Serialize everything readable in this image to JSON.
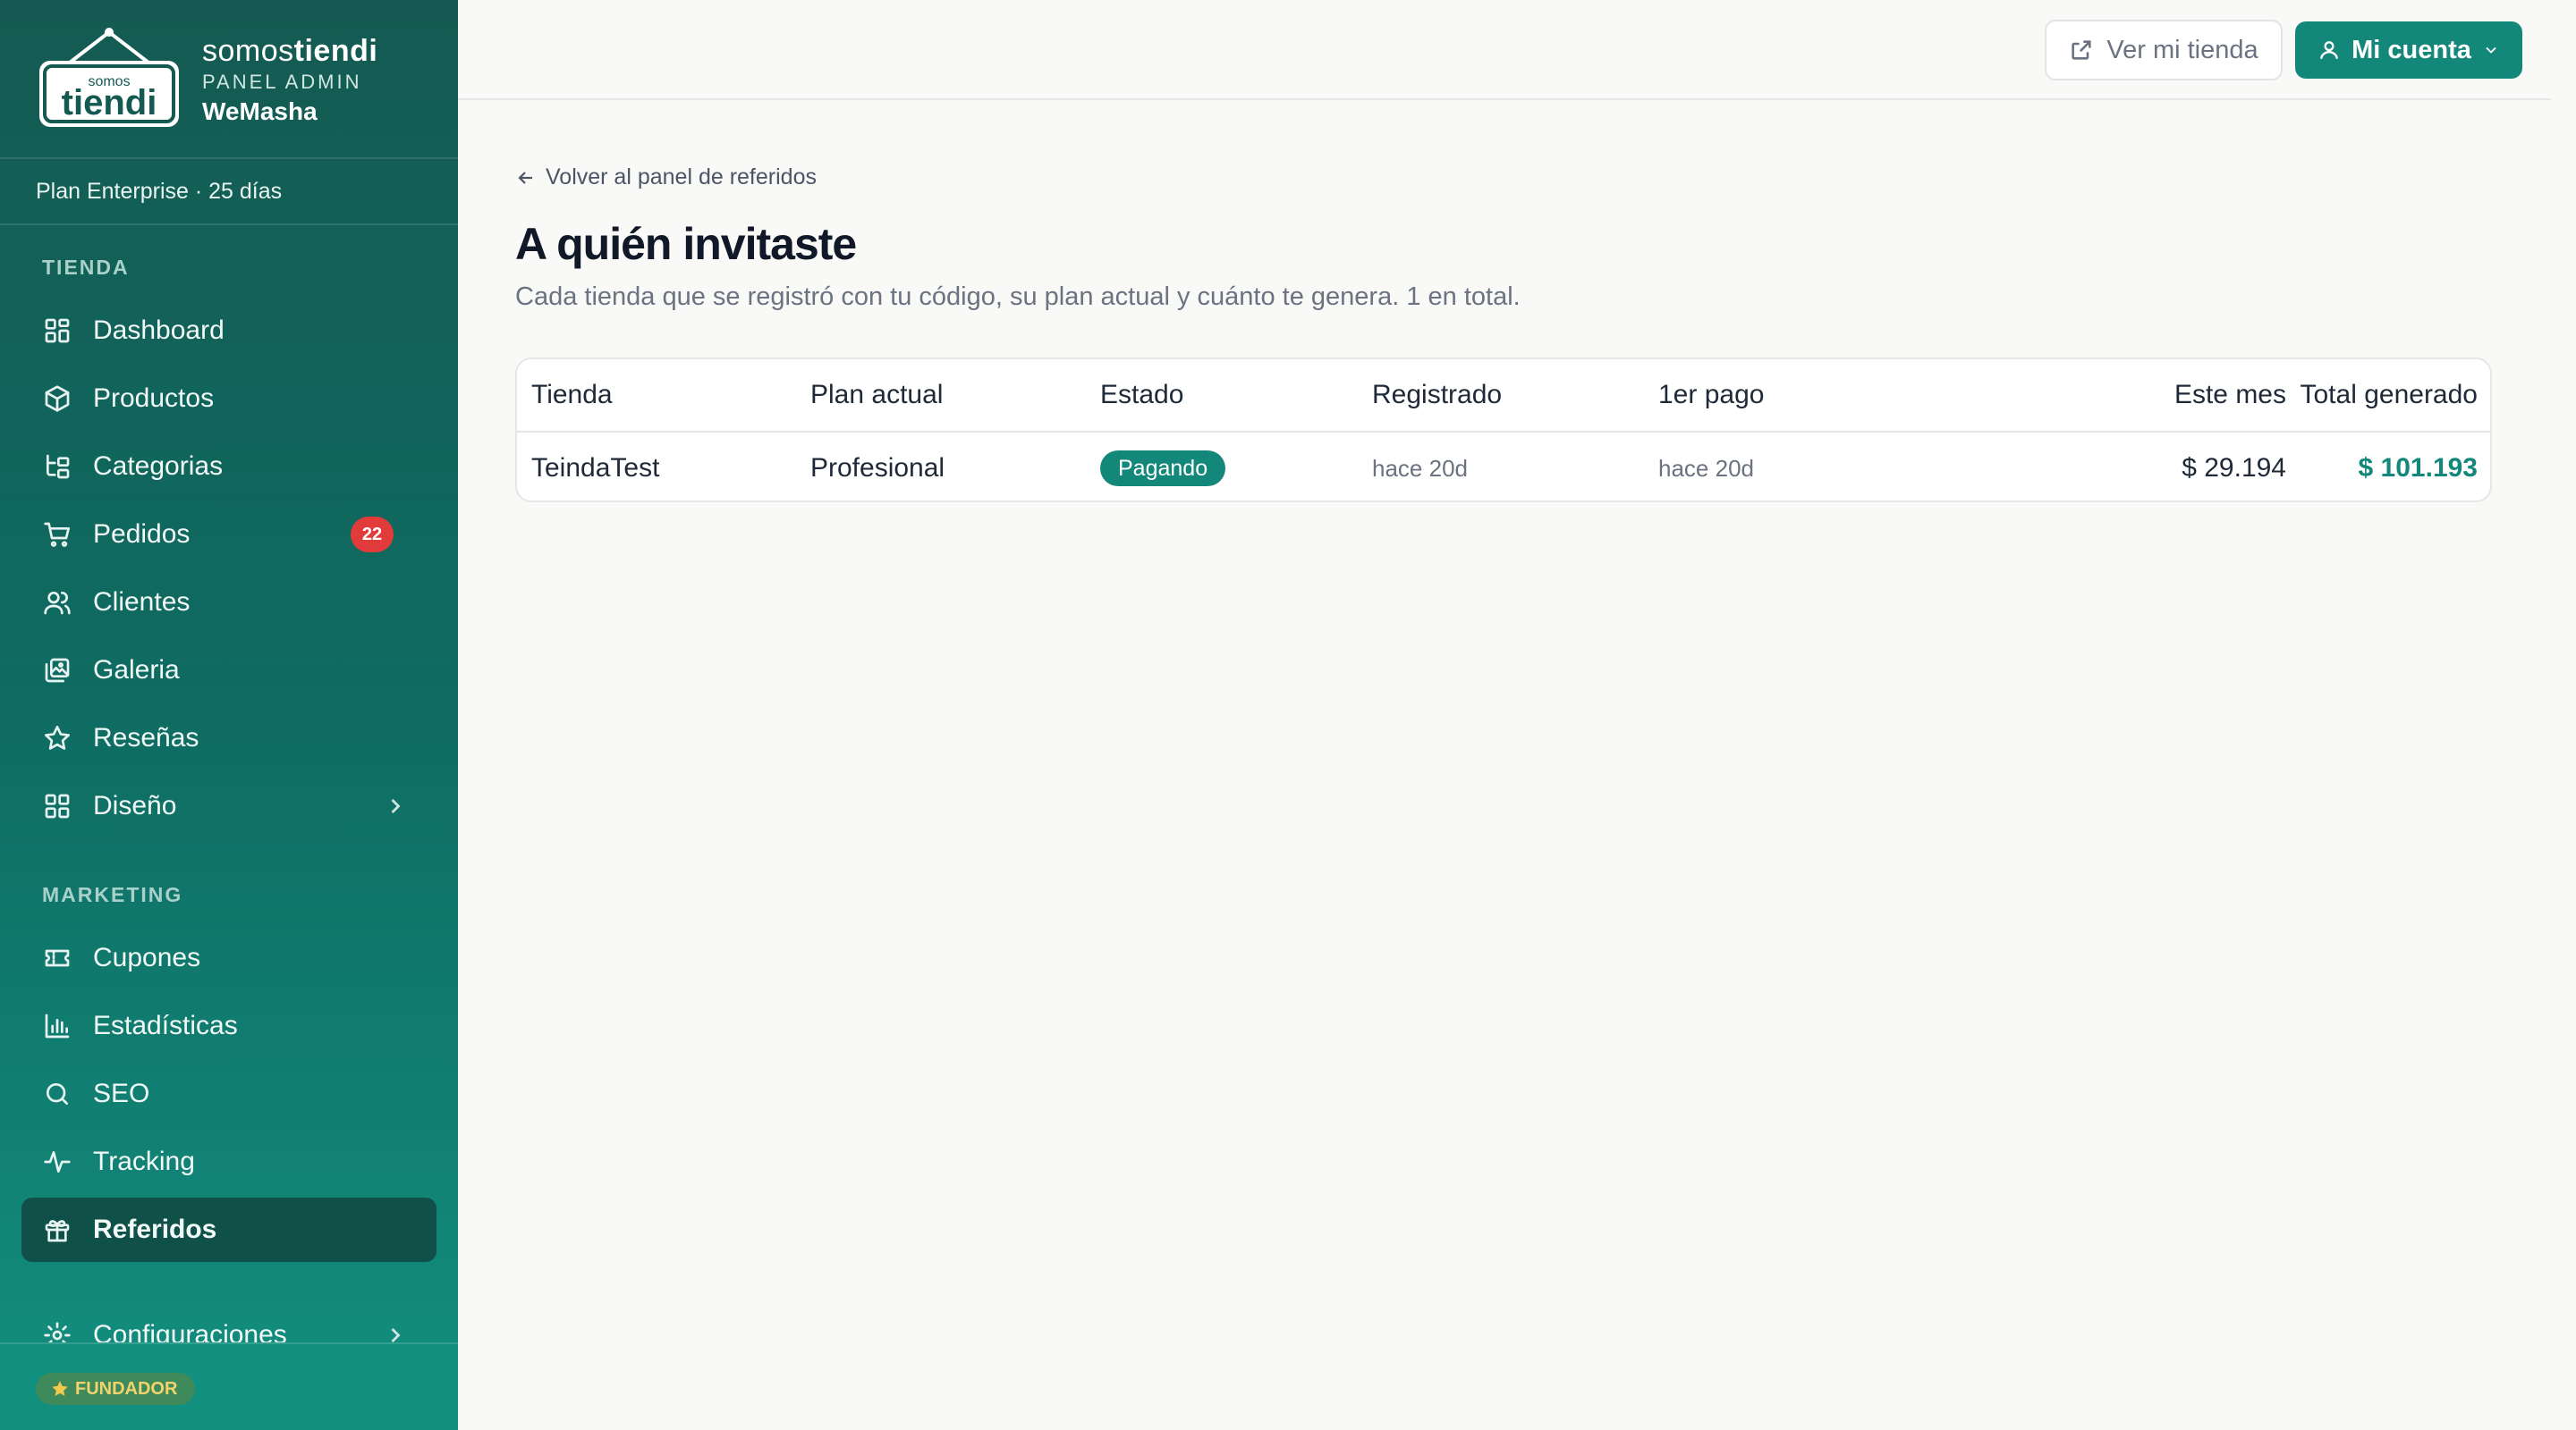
{
  "brand": {
    "name_light": "somos",
    "name_bold": "tiendi",
    "subtitle": "PANEL ADMIN",
    "store": "WeMasha",
    "logo_small": "somos",
    "logo_big": "tiendi"
  },
  "plan": "Plan Enterprise · 25 días",
  "sidebar": {
    "sections": [
      "TIENDA",
      "MARKETING"
    ],
    "items": [
      {
        "label": "Dashboard",
        "icon": "grid-icon"
      },
      {
        "label": "Productos",
        "icon": "box-icon"
      },
      {
        "label": "Categorias",
        "icon": "tree-icon"
      },
      {
        "label": "Pedidos",
        "icon": "cart-icon",
        "badge": "22"
      },
      {
        "label": "Clientes",
        "icon": "users-icon"
      },
      {
        "label": "Galeria",
        "icon": "gallery-icon"
      },
      {
        "label": "Reseñas",
        "icon": "star-icon"
      },
      {
        "label": "Diseño",
        "icon": "layout-icon"
      },
      {
        "label": "Cupones",
        "icon": "ticket-icon"
      },
      {
        "label": "Estadísticas",
        "icon": "bar-chart-icon"
      },
      {
        "label": "SEO",
        "icon": "search-icon"
      },
      {
        "label": "Tracking",
        "icon": "activity-icon"
      },
      {
        "label": "Referidos",
        "icon": "gift-icon",
        "active": true
      },
      {
        "label": "Configuraciones",
        "icon": "gear-icon"
      }
    ],
    "founder_badge": "FUNDADOR"
  },
  "topbar": {
    "view_store": "Ver mi tienda",
    "account": "Mi cuenta"
  },
  "page": {
    "back_link": "Volver al panel de referidos",
    "title": "A quién invitaste",
    "subtitle": "Cada tienda que se registró con tu código, su plan actual y cuánto te genera. 1 en total."
  },
  "table": {
    "headers": [
      "Tienda",
      "Plan actual",
      "Estado",
      "Registrado",
      "1er pago",
      "Este mes",
      "Total generado"
    ],
    "rows": [
      {
        "store": "TeindaTest",
        "plan": "Profesional",
        "status": "Pagando",
        "registered": "hace 20d",
        "first_payment": "hace 20d",
        "this_month": "$ 29.194",
        "total": "$ 101.193"
      }
    ]
  },
  "colors": {
    "accent": "#13877a",
    "sidebar": "#145a52",
    "badge": "#e23b3b"
  }
}
